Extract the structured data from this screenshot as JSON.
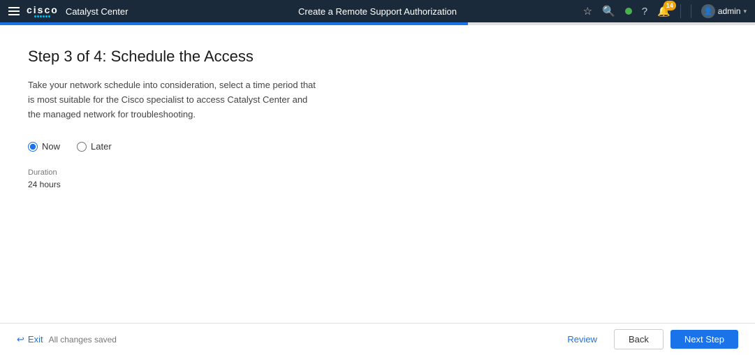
{
  "app": {
    "title": "Catalyst Center",
    "page_title": "Create a Remote Support Authorization"
  },
  "topnav": {
    "user": "admin",
    "notifications_count": "14",
    "status_color": "#4caf50"
  },
  "progress": {
    "percent": 62
  },
  "step": {
    "heading": "Step 3 of 4: Schedule the Access",
    "description": "Take your network schedule into consideration, select a time period that is most suitable for the Cisco specialist to access Catalyst Center and the managed network for troubleshooting.",
    "radio_now_label": "Now",
    "radio_later_label": "Later",
    "duration_label": "Duration",
    "duration_value": "24 hours"
  },
  "footer": {
    "exit_label": "Exit",
    "saved_label": "All changes saved",
    "review_label": "Review",
    "back_label": "Back",
    "next_label": "Next Step"
  }
}
